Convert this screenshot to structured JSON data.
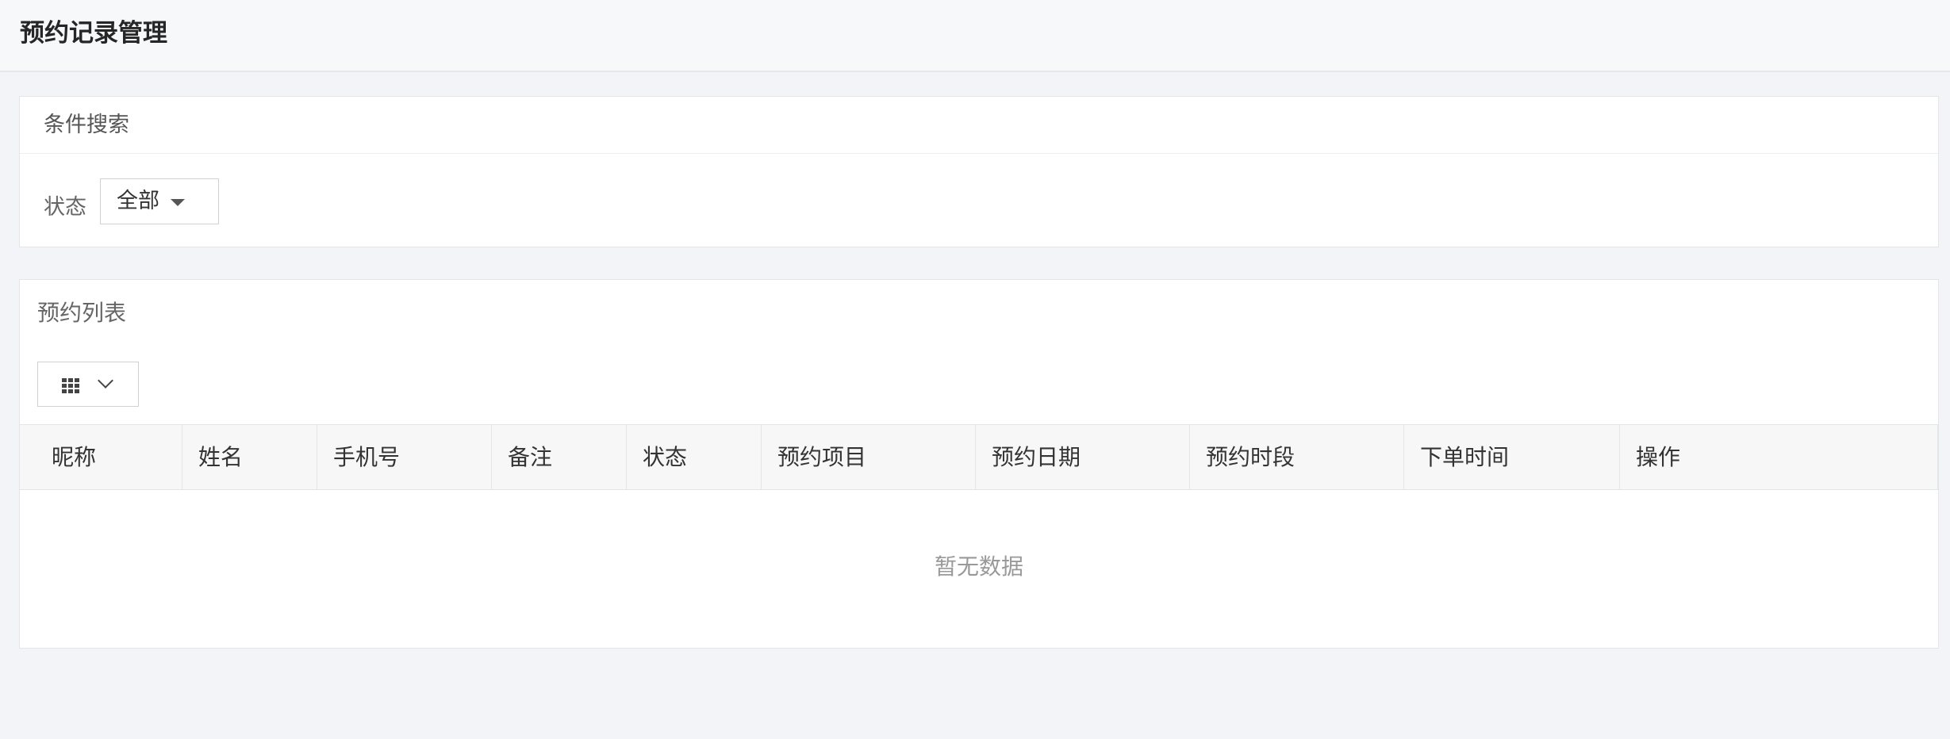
{
  "header": {
    "title": "预约记录管理"
  },
  "search": {
    "title": "条件搜索",
    "status_label": "状态",
    "status_value": "全部"
  },
  "list": {
    "title": "预约列表",
    "columns": [
      "昵称",
      "姓名",
      "手机号",
      "备注",
      "状态",
      "预约项目",
      "预约日期",
      "预约时段",
      "下单时间",
      "操作"
    ],
    "empty_text": "暂无数据"
  }
}
